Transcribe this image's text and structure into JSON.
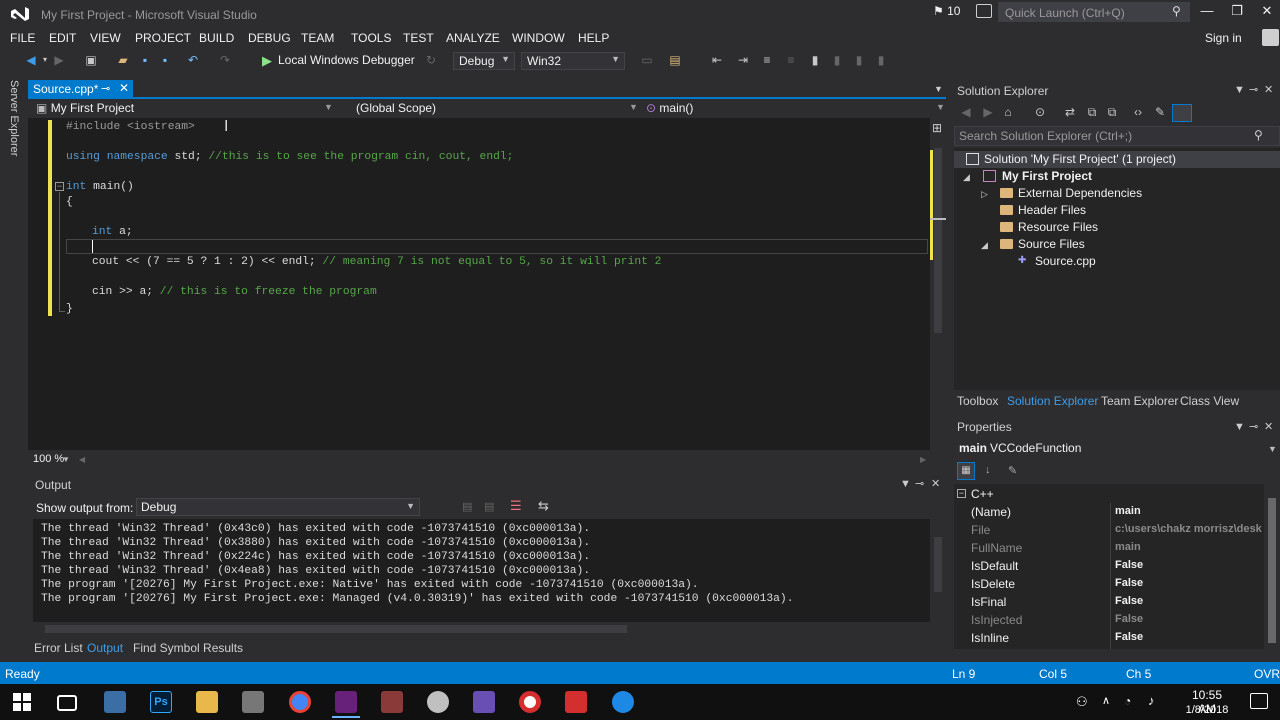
{
  "window": {
    "title": "My First Project - Microsoft Visual Studio",
    "notification_count": "10",
    "quick_launch_placeholder": "Quick Launch (Ctrl+Q)",
    "sign_in": "Sign in"
  },
  "menu": [
    "FILE",
    "EDIT",
    "VIEW",
    "PROJECT",
    "BUILD",
    "DEBUG",
    "TEAM",
    "TOOLS",
    "TEST",
    "ANALYZE",
    "WINDOW",
    "HELP"
  ],
  "toolbar": {
    "run_label": "Local Windows Debugger",
    "config": "Debug",
    "platform": "Win32"
  },
  "side_strip": {
    "server_explorer": "Server Explorer"
  },
  "editor": {
    "tab_label": "Source.cpp*",
    "nav_project": "My First Project",
    "nav_scope": "(Global Scope)",
    "nav_member": "main()",
    "zoom": "100 %",
    "lines": {
      "l1_pp": "#include <iostream>",
      "l3_kw1": "using",
      "l3_kw2": "namespace",
      "l3_rest": " std; ",
      "l3_cm": "//this is to see the program cin, cout, endl;",
      "l5_kw": "int",
      "l5_rest": " main()",
      "l6": "{",
      "l8_kw": "int",
      "l8_rest": " a;",
      "l10_code": "cout << (7 == 5 ? 1 : 2) << endl; ",
      "l10_cm": "// meaning 7 is not equal to 5, so it will print 2",
      "l12_code": "cin >> a; ",
      "l12_cm": "// this is to freeze the program",
      "l13": "}"
    }
  },
  "output": {
    "title": "Output",
    "show_from_label": "Show output from:",
    "show_from_value": "Debug",
    "lines": [
      "The thread 'Win32 Thread' (0x43c0) has exited with code -1073741510 (0xc000013a).",
      "The thread 'Win32 Thread' (0x3880) has exited with code -1073741510 (0xc000013a).",
      "The thread 'Win32 Thread' (0x224c) has exited with code -1073741510 (0xc000013a).",
      "The thread 'Win32 Thread' (0x4ea8) has exited with code -1073741510 (0xc000013a).",
      "The program '[20276] My First Project.exe: Native' has exited with code -1073741510 (0xc000013a).",
      "The program '[20276] My First Project.exe: Managed (v4.0.30319)' has exited with code -1073741510 (0xc000013a)."
    ]
  },
  "bottom_tabs": [
    "Error List",
    "Output",
    "Find Symbol Results"
  ],
  "solution_explorer": {
    "title": "Solution Explorer",
    "search_placeholder": "Search Solution Explorer (Ctrl+;)",
    "solution": "Solution 'My First Project' (1 project)",
    "project": "My First Project",
    "external_deps": "External Dependencies",
    "header_files": "Header Files",
    "resource_files": "Resource Files",
    "source_files": "Source Files",
    "source_cpp": "Source.cpp",
    "tabs": [
      "Toolbox",
      "Solution Explorer",
      "Team Explorer",
      "Class View"
    ]
  },
  "properties": {
    "title": "Properties",
    "object_name": "main",
    "object_type": "VCCodeFunction",
    "category": "C++",
    "rows": [
      {
        "name": "(Name)",
        "value": "main"
      },
      {
        "name": "File",
        "value": "c:\\users\\chakz morrisz\\desk"
      },
      {
        "name": "FullName",
        "value": "main"
      },
      {
        "name": "IsDefault",
        "value": "False"
      },
      {
        "name": "IsDelete",
        "value": "False"
      },
      {
        "name": "IsFinal",
        "value": "False"
      },
      {
        "name": "IsInjected",
        "value": "False"
      },
      {
        "name": "IsInline",
        "value": "False"
      }
    ]
  },
  "status": {
    "ready": "Ready",
    "ln": "Ln 9",
    "col": "Col 5",
    "ch": "Ch 5",
    "ovr": "OVR"
  },
  "taskbar": {
    "time": "10:55 AM",
    "date": "1/8/2018",
    "ps_label": "Ps"
  }
}
